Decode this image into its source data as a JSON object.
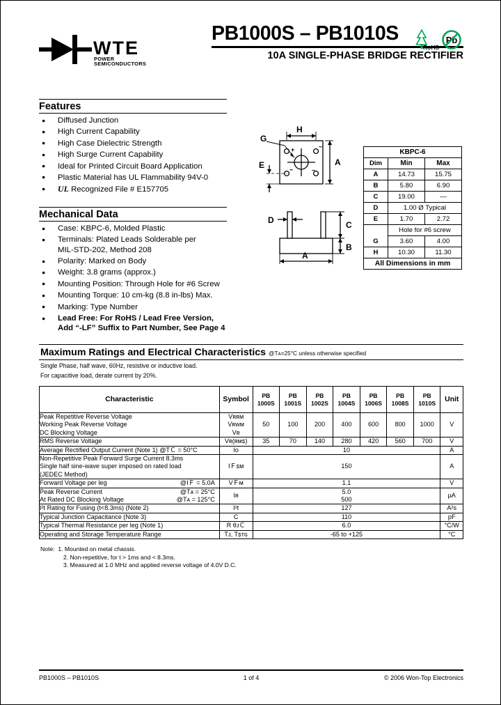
{
  "header": {
    "logo_text": "WTE",
    "logo_subtext": "POWER SEMICONDUCTORS",
    "title": "PB1000S – PB1010S",
    "subtitle": "10A SINGLE-PHASE BRIDGE RECTIFIER",
    "rohs_label": "RoHS",
    "pb_label": "Pb",
    "green_color": "#00a651"
  },
  "features": {
    "heading": "Features",
    "items": [
      "Diffused Junction",
      "High Current Capability",
      "High Case Dielectric Strength",
      "High Surge Current Capability",
      "Ideal for Printed Circuit Board Application",
      "Plastic Material has UL Flammability 94V-0",
      "Recognized File # E157705"
    ],
    "ul_mark": "UL"
  },
  "mechanical": {
    "heading": "Mechanical Data",
    "items": [
      "Case: KBPC-6, Molded Plastic",
      "Terminals: Plated Leads Solderable per",
      "MIL-STD-202, Method 208",
      "Polarity: Marked on Body",
      "Weight: 3.8 grams (approx.)",
      "Mounting Position: Through Hole for #6 Screw",
      "Mounting Torque: 10 cm-kg (8.8 in-lbs) Max.",
      "Marking: Type Number",
      "Lead Free: For RoHS / Lead Free Version,",
      "Add “-LF” Suffix to Part Number, See Page 4"
    ]
  },
  "drawing": {
    "labels": [
      "A",
      "B",
      "C",
      "D",
      "E",
      "G",
      "H"
    ],
    "polarity_plus": "+",
    "polarity_minus": "−"
  },
  "dim_table": {
    "package": "KBPC-6",
    "headers": [
      "Dim",
      "Min",
      "Max"
    ],
    "rows": [
      {
        "dim": "A",
        "min": "14.73",
        "max": "15.75"
      },
      {
        "dim": "B",
        "min": "5.80",
        "max": "6.90"
      },
      {
        "dim": "C",
        "min": "19.00",
        "max": "—"
      },
      {
        "dim": "D",
        "span": "1.00 Ø Typical"
      },
      {
        "dim": "E",
        "min": "1.70",
        "max": "2.72"
      },
      {
        "dim": "G",
        "span": "Hole for #6 screw",
        "min": "3.60",
        "max": "4.00"
      },
      {
        "dim": "H",
        "min": "10.30",
        "max": "11.30"
      }
    ],
    "footer": "All Dimensions in mm"
  },
  "ratings": {
    "heading": "Maximum Ratings and Electrical Characteristics",
    "condition": "@Tᴀ=25°C unless otherwise specified",
    "note_line1": "Single Phase, half wave, 60Hz, resistive or inductive load.",
    "note_line2": "For capacitive load, derate current by 20%.",
    "col_characteristic": "Characteristic",
    "col_symbol": "Symbol",
    "col_unit": "Unit",
    "part_numbers": [
      {
        "prefix": "PB",
        "suffix": "1000S"
      },
      {
        "prefix": "PB",
        "suffix": "1001S"
      },
      {
        "prefix": "PB",
        "suffix": "1002S"
      },
      {
        "prefix": "PB",
        "suffix": "1004S"
      },
      {
        "prefix": "PB",
        "suffix": "1006S"
      },
      {
        "prefix": "PB",
        "suffix": "1008S"
      },
      {
        "prefix": "PB",
        "suffix": "1010S"
      }
    ],
    "rows": [
      {
        "characteristic": [
          "Peak Repetitive Reverse Voltage",
          "Working Peak Reverse Voltage",
          "DC Blocking Voltage"
        ],
        "symbol": [
          "Vʀʀᴍ",
          "Vʀᴡᴍ",
          "Vʀ"
        ],
        "values": [
          "50",
          "100",
          "200",
          "400",
          "600",
          "800",
          "1000"
        ],
        "unit": "V"
      },
      {
        "characteristic": [
          "RMS Reverse Voltage"
        ],
        "symbol": [
          "Vʀ(ʀᴍꜱ)"
        ],
        "values": [
          "35",
          "70",
          "140",
          "280",
          "420",
          "560",
          "700"
        ],
        "unit": "V"
      },
      {
        "characteristic": [
          "Average Rectified Output Current (Note 1) @TＣ = 50°C"
        ],
        "symbol": [
          "Iᴏ"
        ],
        "span_value": "10",
        "unit": "A"
      },
      {
        "characteristic": [
          "Non-Repetitive Peak Forward Surge Current 8.3ms",
          "Single half sine-wave super imposed on rated load",
          "(JEDEC Method)"
        ],
        "symbol": [
          "IＦꜱᴍ"
        ],
        "span_value": "150",
        "unit": "A"
      },
      {
        "characteristic": [
          "Forward Voltage per leg"
        ],
        "cond": "@IＦ = 5.0A",
        "symbol": [
          "VＦᴍ"
        ],
        "span_value": "1.1",
        "unit": "V"
      },
      {
        "characteristic": [
          "Peak Reverse Current",
          "At Rated DC Blocking Voltage"
        ],
        "cond2": [
          "@Tᴀ = 25°C",
          "@Tᴀ = 125°C"
        ],
        "symbol": [
          "Iʀ"
        ],
        "span_value": "5.0\n500",
        "unit": "µA"
      },
      {
        "characteristic": [
          "I²t Rating for Fusing (t<8.3ms) (Note 2)"
        ],
        "symbol": [
          "I²t"
        ],
        "span_value": "127",
        "unit": "A²s"
      },
      {
        "characteristic": [
          "Typical Junction Capacitance (Note 3)"
        ],
        "symbol": [
          "C"
        ],
        "span_value": "110",
        "unit": "pF"
      },
      {
        "characteristic": [
          "Typical Thermal Resistance per leg (Note 1)"
        ],
        "symbol": [
          "R θᴊＣ"
        ],
        "span_value": "6.0",
        "unit": "°C/W"
      },
      {
        "characteristic": [
          "Operating and Storage Temperature Range"
        ],
        "symbol": [
          "Tᴊ, Tꜱᴛɢ"
        ],
        "span_value": "-65 to +125",
        "unit": "°C"
      }
    ],
    "notes_label": "Note:",
    "notes": [
      "1. Mounted on metal chassis.",
      "2. Non-repetitive, for t > 1ms and < 8.3ms.",
      "3. Measured at 1.0 MHz and applied reverse voltage of 4.0V D.C."
    ]
  },
  "footer": {
    "left": "PB1000S – PB1010S",
    "center": "1 of 4",
    "right": "© 2006 Won-Top Electronics"
  }
}
